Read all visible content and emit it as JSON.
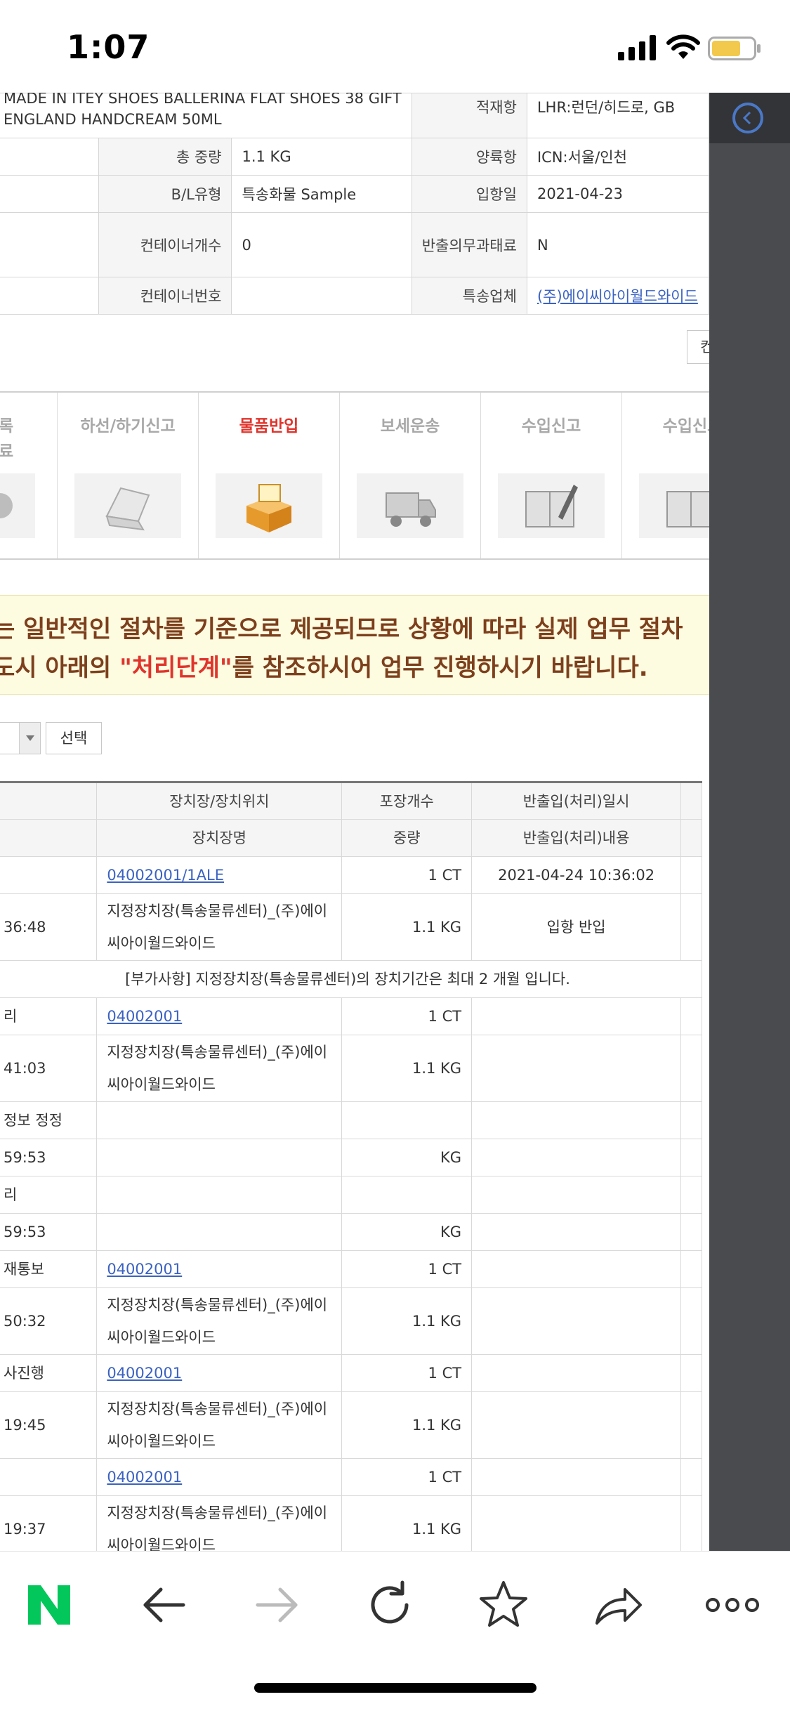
{
  "status": {
    "time": "1:07"
  },
  "info": {
    "rows": [
      {
        "desc": "MADE IN ITEY SHOES BALLERINA FLAT SHOES 38 GIFT",
        "desc2": "ENGLAND HANDCREAM 50ML",
        "label_b": "적재항",
        "value_b": "LHR:런던/히드로, GB"
      },
      {
        "label_a": "총 중량",
        "value_a": "1.1 KG",
        "label_b": "양륙항",
        "value_b": "ICN:서울/인천"
      },
      {
        "label_a": "B/L유형",
        "value_a": "특송화물 Sample",
        "label_b": "입항일",
        "value_b": "2021-04-23"
      },
      {
        "label_a": "컨테이너개수",
        "value_a": "0",
        "label_b": "반출의무과태료",
        "value_b": "N"
      },
      {
        "label_a": "컨테이너번호",
        "value_a": "",
        "label_b": "특송업체",
        "value_b": "(주)에이씨아이월드와이드"
      }
    ],
    "right_btn": "컨"
  },
  "steps": [
    {
      "label": "록\n료"
    },
    {
      "label": "하선/하기신고"
    },
    {
      "label": "물품반입"
    },
    {
      "label": "보세운송"
    },
    {
      "label": "수입신고"
    },
    {
      "label": "수입신고"
    }
  ],
  "notice": {
    "line1": "는 일반적인 절차를 기준으로 제공되므로 상황에 따라 실제 업무 절차",
    "line2_pre": "도시 아래의 ",
    "line2_hl": "\"처리단계\"",
    "line2_post": "를 참조하시어 업무 진행하시기 바랍니다."
  },
  "filter": {
    "select_button": "선택"
  },
  "list": {
    "headers": {
      "row1": [
        "장치장/장치위치",
        "포장개수",
        "반출입(처리)일시"
      ],
      "row2": [
        "장치장명",
        "중량",
        "반출입(처리)내용"
      ]
    },
    "rows": [
      {
        "c1": "",
        "c2": "04002001/1ALE",
        "c2_link": true,
        "c3": "1 CT",
        "c4": "2021-04-24 10:36:02"
      },
      {
        "c1": "36:48",
        "c2": "지정장치장(특송물류센터)_(주)에이씨아이월드와이드",
        "c3": "1.1 KG",
        "c4": "입항 반입",
        "tall": true
      },
      {
        "note": "[부가사항] 지정장치장(특송물류센터)의 장치기간은 최대 2 개월 입니다."
      },
      {
        "c1": "리",
        "c2": "04002001",
        "c2_link": true,
        "c3": "1 CT",
        "c4": ""
      },
      {
        "c1": "41:03",
        "c2": "지정장치장(특송물류센터)_(주)에이씨아이월드와이드",
        "c3": "1.1 KG",
        "c4": "",
        "tall": true
      },
      {
        "c1": "정보 정정",
        "c2": "",
        "c3": "",
        "c4": ""
      },
      {
        "c1": "59:53",
        "c2": "",
        "c3": "KG",
        "c4": ""
      },
      {
        "c1": "리",
        "c2": "",
        "c3": "",
        "c4": ""
      },
      {
        "c1": "59:53",
        "c2": "",
        "c3": "KG",
        "c4": ""
      },
      {
        "c1": "재통보",
        "c2": "04002001",
        "c2_link": true,
        "c3": "1 CT",
        "c4": ""
      },
      {
        "c1": "50:32",
        "c2": "지정장치장(특송물류센터)_(주)에이씨아이월드와이드",
        "c3": "1.1 KG",
        "c4": "",
        "tall": true
      },
      {
        "c1": "사진행",
        "c2": "04002001",
        "c2_link": true,
        "c3": "1 CT",
        "c4": ""
      },
      {
        "c1": "19:45",
        "c2": "지정장치장(특송물류센터)_(주)에이씨아이월드와이드",
        "c3": "1.1 KG",
        "c4": "",
        "tall": true
      },
      {
        "c1": "",
        "c2": "04002001",
        "c2_link": true,
        "c3": "1 CT",
        "c4": ""
      },
      {
        "c1": "19:37",
        "c2": "지정장치장(특송물류센터)_(주)에이씨아이월드와이드",
        "c3": "1.1 KG",
        "c4": "",
        "tall": true
      }
    ]
  },
  "colors": {
    "accent_red": "#e0342c",
    "link": "#3a62c2",
    "notice_text": "#7d3f1c",
    "naver_green": "#03c75a"
  },
  "toolbar": {
    "icons": [
      "naver-home-icon",
      "back-arrow-icon",
      "forward-arrow-icon",
      "reload-icon",
      "bookmark-star-icon",
      "share-icon",
      "more-icon"
    ]
  }
}
